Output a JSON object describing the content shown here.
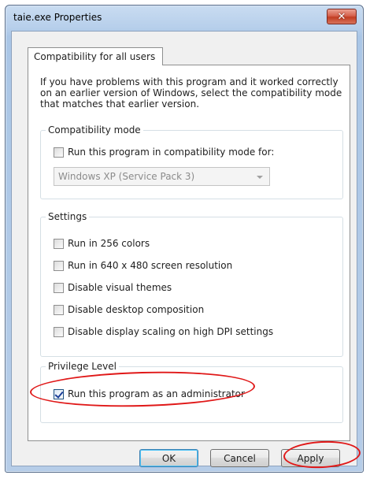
{
  "window": {
    "title": "taie.exe Properties",
    "close_glyph": "✕"
  },
  "tabs": [
    {
      "label": "Compatibility for all users",
      "selected": true
    }
  ],
  "intro_text": "If you have problems with this program and it worked correctly on an earlier version of Windows, select the compatibility mode that matches that earlier version.",
  "compatibility_mode": {
    "group_label": "Compatibility mode",
    "checkbox_label": "Run this program in compatibility mode for:",
    "checked": false,
    "selected_os": "Windows XP (Service Pack 3)",
    "enabled": false
  },
  "settings": {
    "group_label": "Settings",
    "options": [
      {
        "label": "Run in 256 colors",
        "checked": false
      },
      {
        "label": "Run in 640 x 480 screen resolution",
        "checked": false
      },
      {
        "label": "Disable visual themes",
        "checked": false
      },
      {
        "label": "Disable desktop composition",
        "checked": false
      },
      {
        "label": "Disable display scaling on high DPI settings",
        "checked": false
      }
    ]
  },
  "privilege": {
    "group_label": "Privilege Level",
    "checkbox_label": "Run this program as an administrator",
    "checked": true
  },
  "buttons": {
    "ok": "OK",
    "cancel": "Cancel",
    "apply": "Apply"
  },
  "colors": {
    "annotation": "#e01818",
    "title_bar": "#b7cfeb",
    "close_button": "#c13d22"
  }
}
